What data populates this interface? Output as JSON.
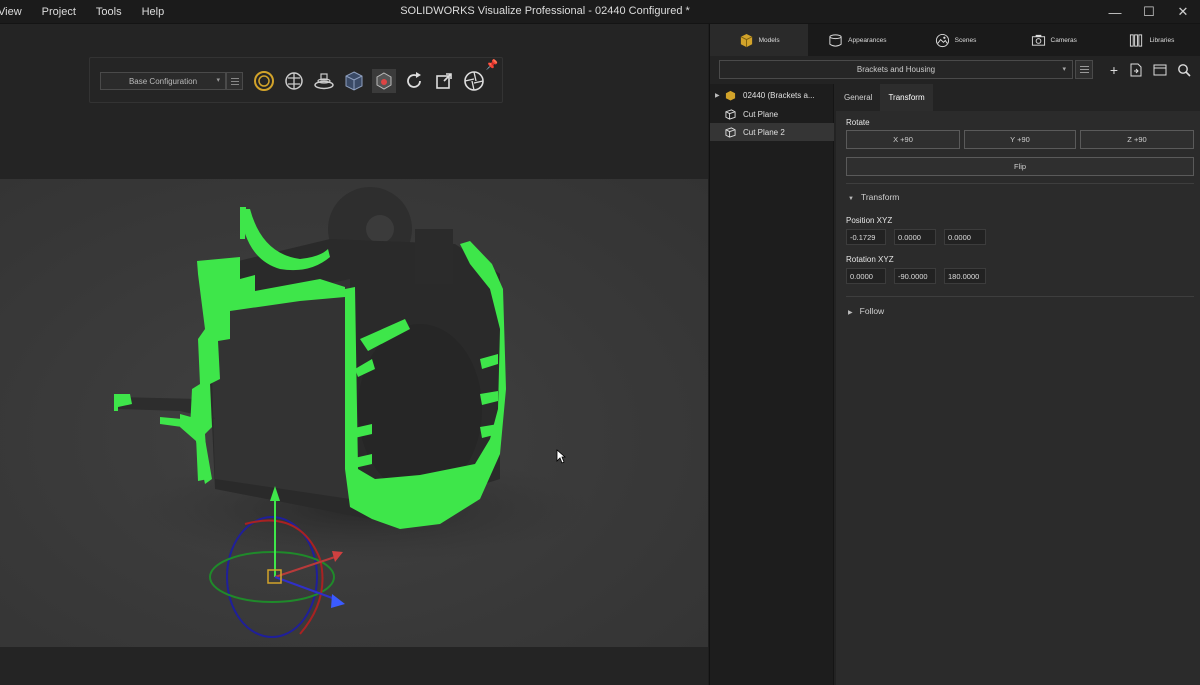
{
  "menu": [
    "View",
    "Project",
    "Tools",
    "Help"
  ],
  "window_title": "SOLIDWORKS Visualize Professional - 02440 Configured *",
  "window_controls": {
    "minimize": "—",
    "maximize": "☐",
    "close": "✕"
  },
  "toolbar": {
    "configuration": "Base Configuration",
    "icons": [
      "render-mode-icon",
      "scene-tree-icon",
      "turntable-icon",
      "view-cube-icon",
      "object-select-icon",
      "refresh-icon",
      "export-icon",
      "camera-shutter-icon"
    ]
  },
  "panel": {
    "tabs": [
      "Models",
      "Appearances",
      "Scenes",
      "Cameras",
      "Libraries"
    ],
    "model_group": "Brackets and Housing",
    "tree": [
      {
        "label": "02440 (Brackets a...",
        "expand": "▶"
      },
      {
        "label": "Cut Plane"
      },
      {
        "label": "Cut Plane 2"
      }
    ],
    "subtabs": [
      "General",
      "Transform"
    ],
    "rotate_label": "Rotate",
    "rotate_buttons": [
      "X +90",
      "Y +90",
      "Z +90"
    ],
    "flip_label": "Flip",
    "transform_header": "Transform",
    "position_label": "Position XYZ",
    "position": [
      "-0.1729",
      "0.0000",
      "0.0000"
    ],
    "rotation_label": "Rotation XYZ",
    "rotation": [
      "0.0000",
      "-90.0000",
      "180.0000"
    ],
    "follow_label": "Follow"
  },
  "colors": {
    "cut_face": "#3ee64a",
    "model_body": "#2c2c2c",
    "accent_gold": "#d2a32a"
  }
}
